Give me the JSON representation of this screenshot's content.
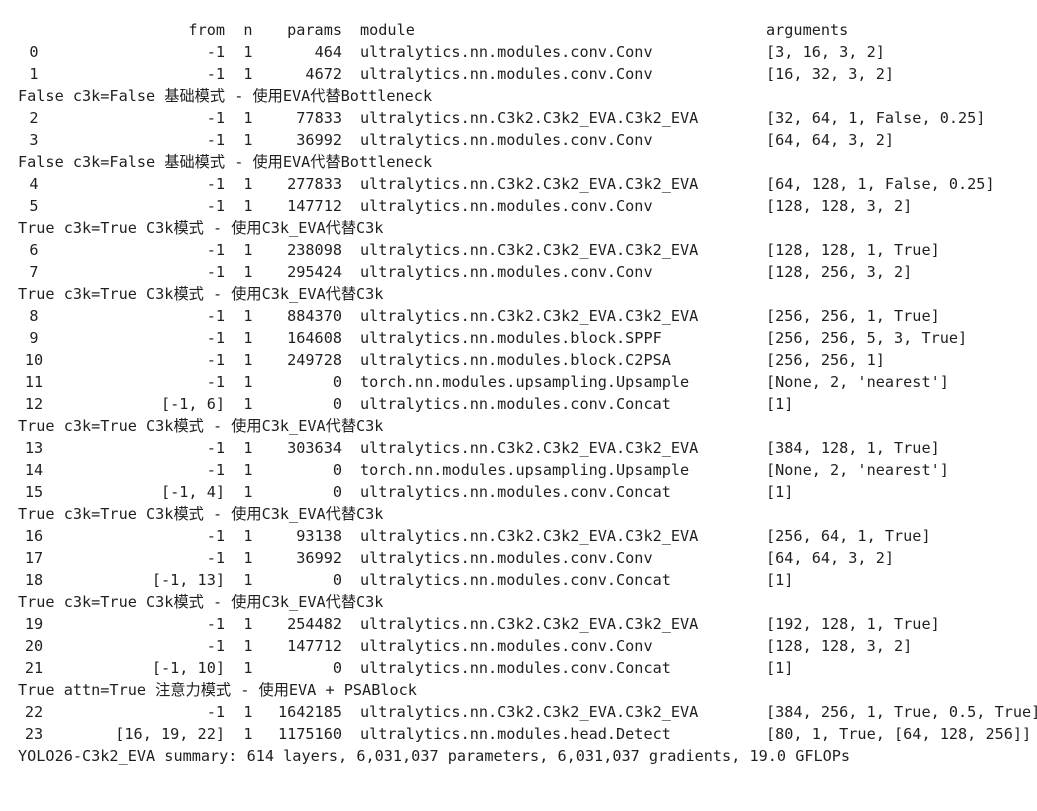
{
  "header": {
    "from": "from",
    "n": "n",
    "params": "params",
    "module": "module",
    "arguments": "arguments"
  },
  "lines": [
    {
      "type": "row",
      "idx": "0",
      "from": "-1",
      "n": "1",
      "params": "464",
      "module": "ultralytics.nn.modules.conv.Conv",
      "args": "[3, 16, 3, 2]"
    },
    {
      "type": "row",
      "idx": "1",
      "from": "-1",
      "n": "1",
      "params": "4672",
      "module": "ultralytics.nn.modules.conv.Conv",
      "args": "[16, 32, 3, 2]"
    },
    {
      "type": "note",
      "text": "False c3k=False 基础模式 - 使用EVA代替Bottleneck"
    },
    {
      "type": "row",
      "idx": "2",
      "from": "-1",
      "n": "1",
      "params": "77833",
      "module": "ultralytics.nn.C3k2.C3k2_EVA.C3k2_EVA",
      "args": "[32, 64, 1, False, 0.25]"
    },
    {
      "type": "row",
      "idx": "3",
      "from": "-1",
      "n": "1",
      "params": "36992",
      "module": "ultralytics.nn.modules.conv.Conv",
      "args": "[64, 64, 3, 2]"
    },
    {
      "type": "note",
      "text": "False c3k=False 基础模式 - 使用EVA代替Bottleneck"
    },
    {
      "type": "row",
      "idx": "4",
      "from": "-1",
      "n": "1",
      "params": "277833",
      "module": "ultralytics.nn.C3k2.C3k2_EVA.C3k2_EVA",
      "args": "[64, 128, 1, False, 0.25]"
    },
    {
      "type": "row",
      "idx": "5",
      "from": "-1",
      "n": "1",
      "params": "147712",
      "module": "ultralytics.nn.modules.conv.Conv",
      "args": "[128, 128, 3, 2]"
    },
    {
      "type": "note",
      "text": "True c3k=True C3k模式 - 使用C3k_EVA代替C3k"
    },
    {
      "type": "row",
      "idx": "6",
      "from": "-1",
      "n": "1",
      "params": "238098",
      "module": "ultralytics.nn.C3k2.C3k2_EVA.C3k2_EVA",
      "args": "[128, 128, 1, True]"
    },
    {
      "type": "row",
      "idx": "7",
      "from": "-1",
      "n": "1",
      "params": "295424",
      "module": "ultralytics.nn.modules.conv.Conv",
      "args": "[128, 256, 3, 2]"
    },
    {
      "type": "note",
      "text": "True c3k=True C3k模式 - 使用C3k_EVA代替C3k"
    },
    {
      "type": "row",
      "idx": "8",
      "from": "-1",
      "n": "1",
      "params": "884370",
      "module": "ultralytics.nn.C3k2.C3k2_EVA.C3k2_EVA",
      "args": "[256, 256, 1, True]"
    },
    {
      "type": "row",
      "idx": "9",
      "from": "-1",
      "n": "1",
      "params": "164608",
      "module": "ultralytics.nn.modules.block.SPPF",
      "args": "[256, 256, 5, 3, True]"
    },
    {
      "type": "row",
      "idx": "10",
      "from": "-1",
      "n": "1",
      "params": "249728",
      "module": "ultralytics.nn.modules.block.C2PSA",
      "args": "[256, 256, 1]"
    },
    {
      "type": "row",
      "idx": "11",
      "from": "-1",
      "n": "1",
      "params": "0",
      "module": "torch.nn.modules.upsampling.Upsample",
      "args": "[None, 2, 'nearest']"
    },
    {
      "type": "row",
      "idx": "12",
      "from": "[-1, 6]",
      "n": "1",
      "params": "0",
      "module": "ultralytics.nn.modules.conv.Concat",
      "args": "[1]"
    },
    {
      "type": "note",
      "text": "True c3k=True C3k模式 - 使用C3k_EVA代替C3k"
    },
    {
      "type": "row",
      "idx": "13",
      "from": "-1",
      "n": "1",
      "params": "303634",
      "module": "ultralytics.nn.C3k2.C3k2_EVA.C3k2_EVA",
      "args": "[384, 128, 1, True]"
    },
    {
      "type": "row",
      "idx": "14",
      "from": "-1",
      "n": "1",
      "params": "0",
      "module": "torch.nn.modules.upsampling.Upsample",
      "args": "[None, 2, 'nearest']"
    },
    {
      "type": "row",
      "idx": "15",
      "from": "[-1, 4]",
      "n": "1",
      "params": "0",
      "module": "ultralytics.nn.modules.conv.Concat",
      "args": "[1]"
    },
    {
      "type": "note",
      "text": "True c3k=True C3k模式 - 使用C3k_EVA代替C3k"
    },
    {
      "type": "row",
      "idx": "16",
      "from": "-1",
      "n": "1",
      "params": "93138",
      "module": "ultralytics.nn.C3k2.C3k2_EVA.C3k2_EVA",
      "args": "[256, 64, 1, True]"
    },
    {
      "type": "row",
      "idx": "17",
      "from": "-1",
      "n": "1",
      "params": "36992",
      "module": "ultralytics.nn.modules.conv.Conv",
      "args": "[64, 64, 3, 2]"
    },
    {
      "type": "row",
      "idx": "18",
      "from": "[-1, 13]",
      "n": "1",
      "params": "0",
      "module": "ultralytics.nn.modules.conv.Concat",
      "args": "[1]"
    },
    {
      "type": "note",
      "text": "True c3k=True C3k模式 - 使用C3k_EVA代替C3k"
    },
    {
      "type": "row",
      "idx": "19",
      "from": "-1",
      "n": "1",
      "params": "254482",
      "module": "ultralytics.nn.C3k2.C3k2_EVA.C3k2_EVA",
      "args": "[192, 128, 1, True]"
    },
    {
      "type": "row",
      "idx": "20",
      "from": "-1",
      "n": "1",
      "params": "147712",
      "module": "ultralytics.nn.modules.conv.Conv",
      "args": "[128, 128, 3, 2]"
    },
    {
      "type": "row",
      "idx": "21",
      "from": "[-1, 10]",
      "n": "1",
      "params": "0",
      "module": "ultralytics.nn.modules.conv.Concat",
      "args": "[1]"
    },
    {
      "type": "note",
      "text": "True attn=True 注意力模式 - 使用EVA + PSABlock"
    },
    {
      "type": "row",
      "idx": "22",
      "from": "-1",
      "n": "1",
      "params": "1642185",
      "module": "ultralytics.nn.C3k2.C3k2_EVA.C3k2_EVA",
      "args": "[384, 256, 1, True, 0.5, True]"
    },
    {
      "type": "row",
      "idx": "23",
      "from": "[16, 19, 22]",
      "n": "1",
      "params": "1175160",
      "module": "ultralytics.nn.modules.head.Detect",
      "args": "[80, 1, True, [64, 128, 256]]"
    }
  ],
  "summary": "YOLO26-C3k2_EVA summary: 614 layers, 6,031,037 parameters, 6,031,037 gradients, 19.0 GFLOPs"
}
